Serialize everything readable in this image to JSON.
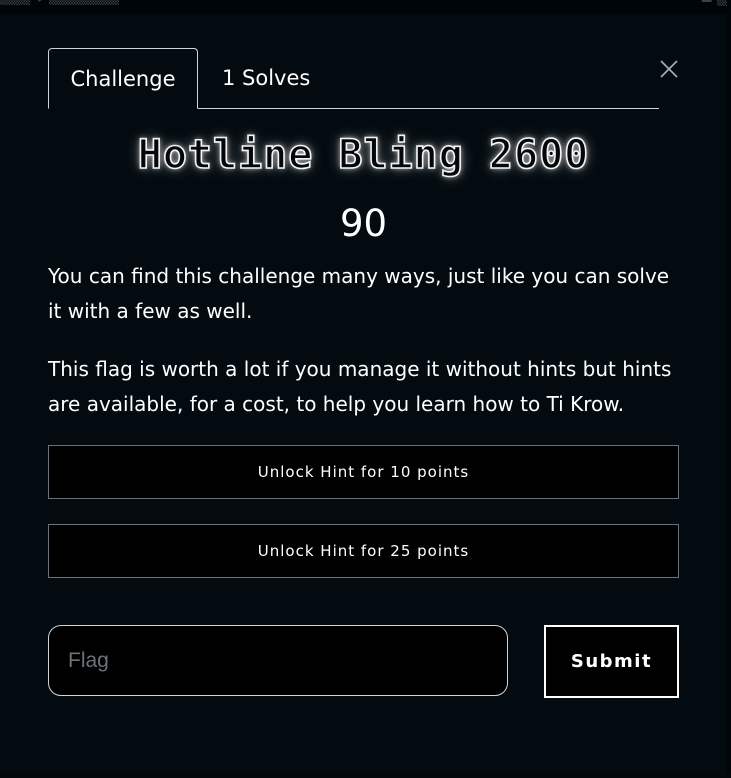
{
  "tabs": [
    {
      "label": "Challenge",
      "active": true
    },
    {
      "label": "1 Solves",
      "active": false
    }
  ],
  "challenge": {
    "name": "Hotline Bling 2600",
    "points": "90",
    "description": [
      "You can find this challenge many ways, just like you can solve it with a few as well.",
      "This flag is worth a lot if you manage it without hints but hints are available, for a cost, to help you learn how to Ti Krow."
    ]
  },
  "hints": [
    {
      "label": "Unlock Hint for 10 points"
    },
    {
      "label": "Unlock Hint for 25 points"
    }
  ],
  "flag_form": {
    "placeholder": "Flag",
    "value": "",
    "submit_label": "Submit"
  },
  "icons": {
    "close": "close-icon"
  },
  "colors": {
    "background": "#03080c",
    "text": "#ffffff",
    "border": "#cfd4d8",
    "hint_border": "#6b7178",
    "placeholder": "#6c7278"
  }
}
